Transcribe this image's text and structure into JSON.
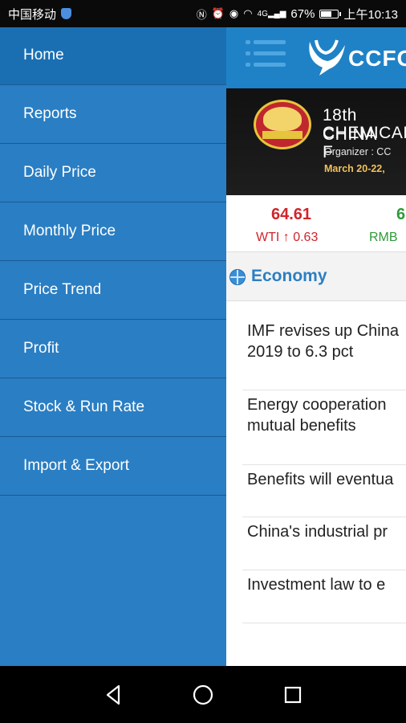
{
  "status_bar": {
    "carrier": "中国移动",
    "icons": [
      "nfc-icon",
      "alarm-icon",
      "eye-icon",
      "wifi-icon",
      "signal-icon",
      "battery-icon"
    ],
    "signal_label": "4G",
    "battery": "67%",
    "battery_level": 0.67,
    "time": "上午10:13"
  },
  "drawer": {
    "items": [
      {
        "label": "Home"
      },
      {
        "label": "Reports"
      },
      {
        "label": "Daily Price"
      },
      {
        "label": "Monthly Price"
      },
      {
        "label": "Price Trend"
      },
      {
        "label": "Profit"
      },
      {
        "label": "Stock & Run Rate"
      },
      {
        "label": "Import & Export"
      }
    ]
  },
  "app_bar": {
    "logo_text": "CCFG"
  },
  "banner": {
    "title_line1": "18th CHINA",
    "title_line2": "CHEMICAL F",
    "organizer": "Organizer : CC",
    "date": "March 20-22,"
  },
  "ticker": [
    {
      "value": "64.61",
      "label": "WTI ↑ 0.63",
      "color": "#d0252b"
    },
    {
      "value": "6",
      "label": "RMB",
      "color": "#2e9a3a"
    }
  ],
  "economy": {
    "title": "Economy",
    "news": [
      "IMF revises up China\n2019 to 6.3 pct",
      "Energy cooperation\nmutual benefits",
      "Benefits will eventua",
      "China's industrial pr",
      "Investment law to e"
    ]
  },
  "colors": {
    "drawer_bg": "#2a7ec3",
    "drawer_active": "#1a6fb3",
    "app_bar": "#1f82c7",
    "accent": "#2c7fc2"
  }
}
